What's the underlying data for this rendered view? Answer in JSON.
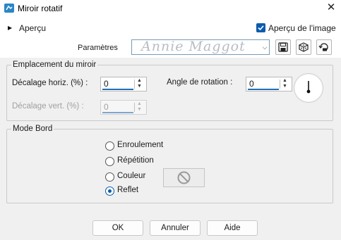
{
  "window": {
    "title": "Miroir rotatif",
    "close_glyph": "✕",
    "icon": "paintshop-app-icon"
  },
  "preview": {
    "expander_glyph": "▶",
    "label": "Aperçu",
    "image_preview_label": "Aperçu de l'image",
    "image_preview_checked": true
  },
  "presets": {
    "label": "Paramètres",
    "value": "",
    "watermark_text": "Annie Maggot",
    "buttons": [
      "save-preset-icon",
      "randomize-icon",
      "reset-icon"
    ]
  },
  "mirror_location": {
    "legend": "Emplacement du miroir",
    "horiz_offset_label": "Décalage horiz. (%) :",
    "horiz_offset_value": "0",
    "vert_offset_label": "Décalage vert. (%) :",
    "vert_offset_value": "0",
    "vert_offset_enabled": false,
    "rotation_label": "Angle de rotation :",
    "rotation_value": "0"
  },
  "edge_mode": {
    "legend": "Mode Bord",
    "options": [
      "Enroulement",
      "Répétition",
      "Couleur",
      "Reflet"
    ],
    "selected": "Reflet"
  },
  "footer": {
    "ok_label": "OK",
    "cancel_label": "Annuler",
    "help_label": "Aide"
  },
  "colors": {
    "accent": "#0b5cad",
    "window_bg": "#f0f0f0",
    "top_bg": "#ffffff",
    "disabled_text": "#a0a0a0"
  }
}
